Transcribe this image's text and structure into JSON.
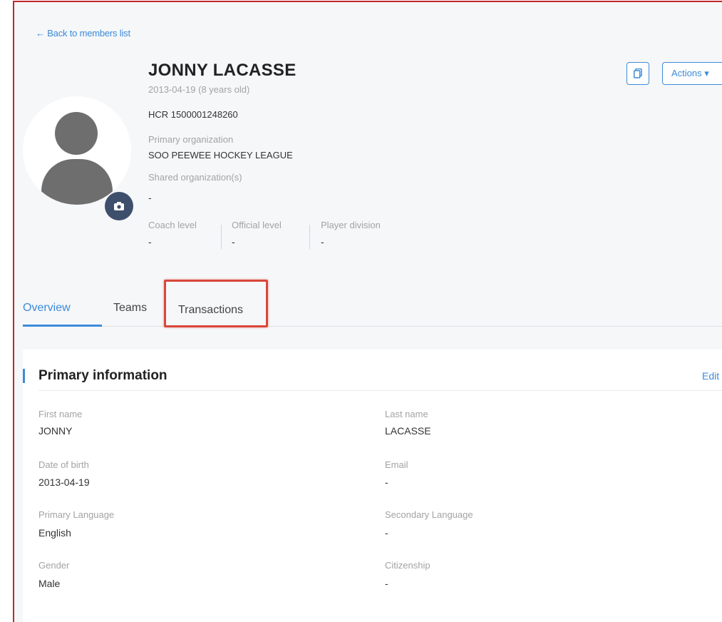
{
  "nav": {
    "back_link": "← Back to members list"
  },
  "member": {
    "name": "JONNY LACASSE",
    "dob_line": "2013-04-19 (8 years old)",
    "hcr": "HCR  1500001248260",
    "primary_org_label": "Primary organization",
    "primary_org_value": "SOO PEEWEE HOCKEY LEAGUE",
    "shared_org_label": "Shared organization(s)",
    "shared_org_value": "-",
    "levels": [
      {
        "label": "Coach level",
        "value": "-"
      },
      {
        "label": "Official level",
        "value": "-"
      },
      {
        "label": "Player division",
        "value": "-"
      }
    ]
  },
  "actions": {
    "copy_icon": "copy-icon",
    "actions_label": "Actions ▾"
  },
  "tabs": [
    {
      "label": "Overview",
      "active": true
    },
    {
      "label": "Teams",
      "active": false
    },
    {
      "label": "Transactions",
      "active": false,
      "highlighted": true
    }
  ],
  "primary_info": {
    "title": "Primary information",
    "edit_label": "Edit",
    "fields": [
      {
        "label": "First name",
        "value": "JONNY"
      },
      {
        "label": "Last name",
        "value": "LACASSE"
      },
      {
        "label": "Date of birth",
        "value": "2013-04-19"
      },
      {
        "label": "Email",
        "value": "-"
      },
      {
        "label": "Primary Language",
        "value": "English"
      },
      {
        "label": "Secondary Language",
        "value": "-"
      },
      {
        "label": "Gender",
        "value": "Male"
      },
      {
        "label": "Citizenship",
        "value": "-"
      }
    ]
  },
  "colors": {
    "accent": "#3d8bd9",
    "highlight_border": "#d9473b",
    "frame_border": "#c0262c",
    "avatar_badge": "#3e4f6b"
  }
}
